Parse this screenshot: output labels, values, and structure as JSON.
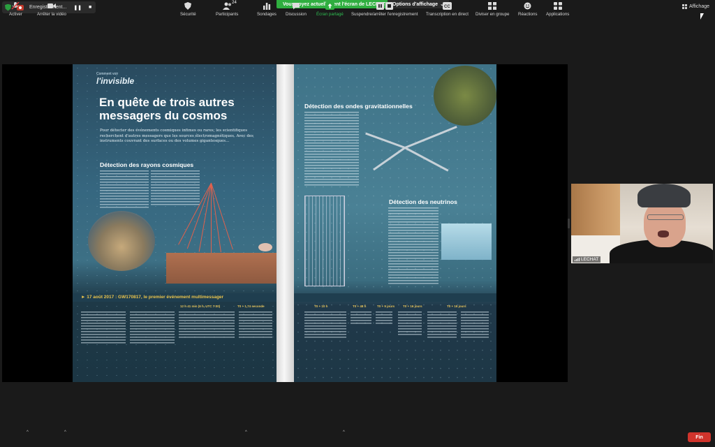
{
  "topbar": {
    "recording_label": "Enregistrement...",
    "pause_icon": "pause-icon",
    "stop_icon": "stop-icon",
    "share_banner": "Vous voyez actuellement l'écran de LECHAT",
    "view_options": "Options d'affichage",
    "view_label": "Affichage"
  },
  "magazine": {
    "brand_small": "Comment voir",
    "brand_big": "l'invisible",
    "title": "En quête de trois autres messagers du cosmos",
    "intro": "Pour détecter des événements cosmiques infimes ou rares, les scientifiques recherchent d'autres messagers que les sources électromagnétiques. Avec des instruments couvrant des surfaces ou des volumes gigantesques...",
    "section_rays": "Détection des rayons cosmiques",
    "section_waves": "Détection des ondes gravitationnelles",
    "section_neutrinos": "Détection des neutrinos",
    "event_title": "► 17 août 2017 : GW170817, le premier événement multimessager",
    "timeline": [
      "12 h 41 min (6 h, UTC 7:00)",
      "T0 + 1,74 seconde",
      "T0 + 10 h",
      "T0 + 48 h",
      "T0 + 9 jours",
      "T0 + 16 jours",
      "T0 + 16 jours"
    ]
  },
  "participant": {
    "name": "LECHAT"
  },
  "toolbar": {
    "items": [
      {
        "label": "Activer",
        "icon": "microphone-muted-icon"
      },
      {
        "label": "Arrêter la vidéo",
        "icon": "video-camera-icon"
      },
      {
        "label": "Sécurité",
        "icon": "shield-icon"
      },
      {
        "label": "Participants",
        "icon": "participants-icon",
        "count": "24"
      },
      {
        "label": "Sondages",
        "icon": "poll-icon"
      },
      {
        "label": "Discussion",
        "icon": "chat-icon"
      },
      {
        "label": "Écran partagé",
        "icon": "share-screen-icon"
      },
      {
        "label": "Suspendre/arrêter l'enregistrement",
        "icon": "record-controls-icon"
      },
      {
        "label": "Transcription en direct",
        "icon": "cc-icon"
      },
      {
        "label": "Diviser en groupe",
        "icon": "breakout-icon"
      },
      {
        "label": "Réactions",
        "icon": "reaction-icon"
      },
      {
        "label": "Applications",
        "icon": "apps-icon"
      }
    ],
    "end_label": "Fin"
  },
  "colors": {
    "share_banner": "#2fae3f",
    "end_button": "#d0342c",
    "security_shield": "#2a9d3f"
  }
}
